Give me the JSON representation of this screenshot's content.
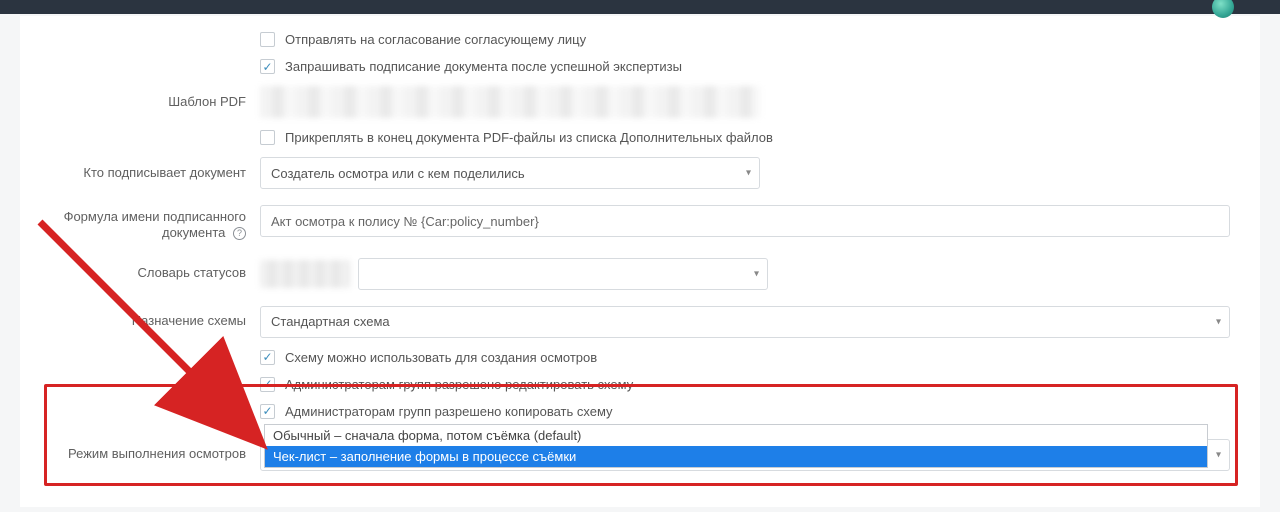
{
  "checks": {
    "send_for_approval": "Отправлять на согласование согласующему лицу",
    "request_signature": "Запрашивать подписание документа после успешной экспертизы",
    "attach_pdf": "Прикреплять в конец документа PDF-файлы из списка Дополнительных файлов",
    "scheme_create": "Схему можно использовать для создания осмотров",
    "admins_edit": "Администраторам групп разрешено редактировать схему",
    "admins_copy": "Администраторам групп разрешено копировать схему"
  },
  "labels": {
    "pdf_template": "Шаблон PDF",
    "who_signs": "Кто подписывает документ",
    "signed_name_formula": "Формула имени подписанного документа",
    "status_dict": "Словарь статусов",
    "scheme_purpose": "Назначение схемы",
    "execution_mode": "Режим выполнения осмотров"
  },
  "values": {
    "who_signs": "Создатель осмотра или с кем поделились",
    "signed_name_formula": "Акт осмотра к полису № {Car:policy_number}",
    "scheme_purpose": "Стандартная схема",
    "execution_mode": "Чек-лист – заполнение формы в процессе съёмки"
  },
  "dropdown": {
    "opt_default": "Обычный – сначала форма, потом съёмка (default)",
    "opt_checklist": "Чек-лист – заполнение формы в процессе съёмки"
  },
  "help_glyph": "?"
}
